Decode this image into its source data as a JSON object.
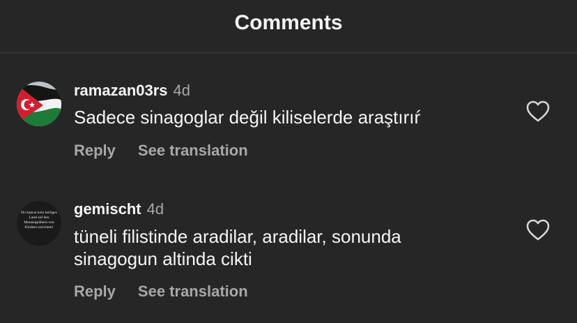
{
  "header": {
    "title": "Comments"
  },
  "comments": [
    {
      "username": "ramazan03rs",
      "time": "4d",
      "text": "Sadece sinagoglar değil kiliselerde araştırıŕ",
      "reply_label": "Reply",
      "translate_label": "See translation",
      "avatar_icon": "palestine-flag-avatar"
    },
    {
      "username": "gemischt",
      "time": "4d",
      "text": "tüneli filistinde aradilar, aradilar, sonunda sinagogun altinda cikti",
      "reply_label": "Reply",
      "translate_label": "See translation",
      "avatar_text": "Du kannst kein heiliges Land auf den Massengräbern von Kindern errichten!"
    }
  ],
  "colors": {
    "background": "#262626",
    "primary_text": "#f5f5f5",
    "secondary_text": "#a8a8a8"
  }
}
